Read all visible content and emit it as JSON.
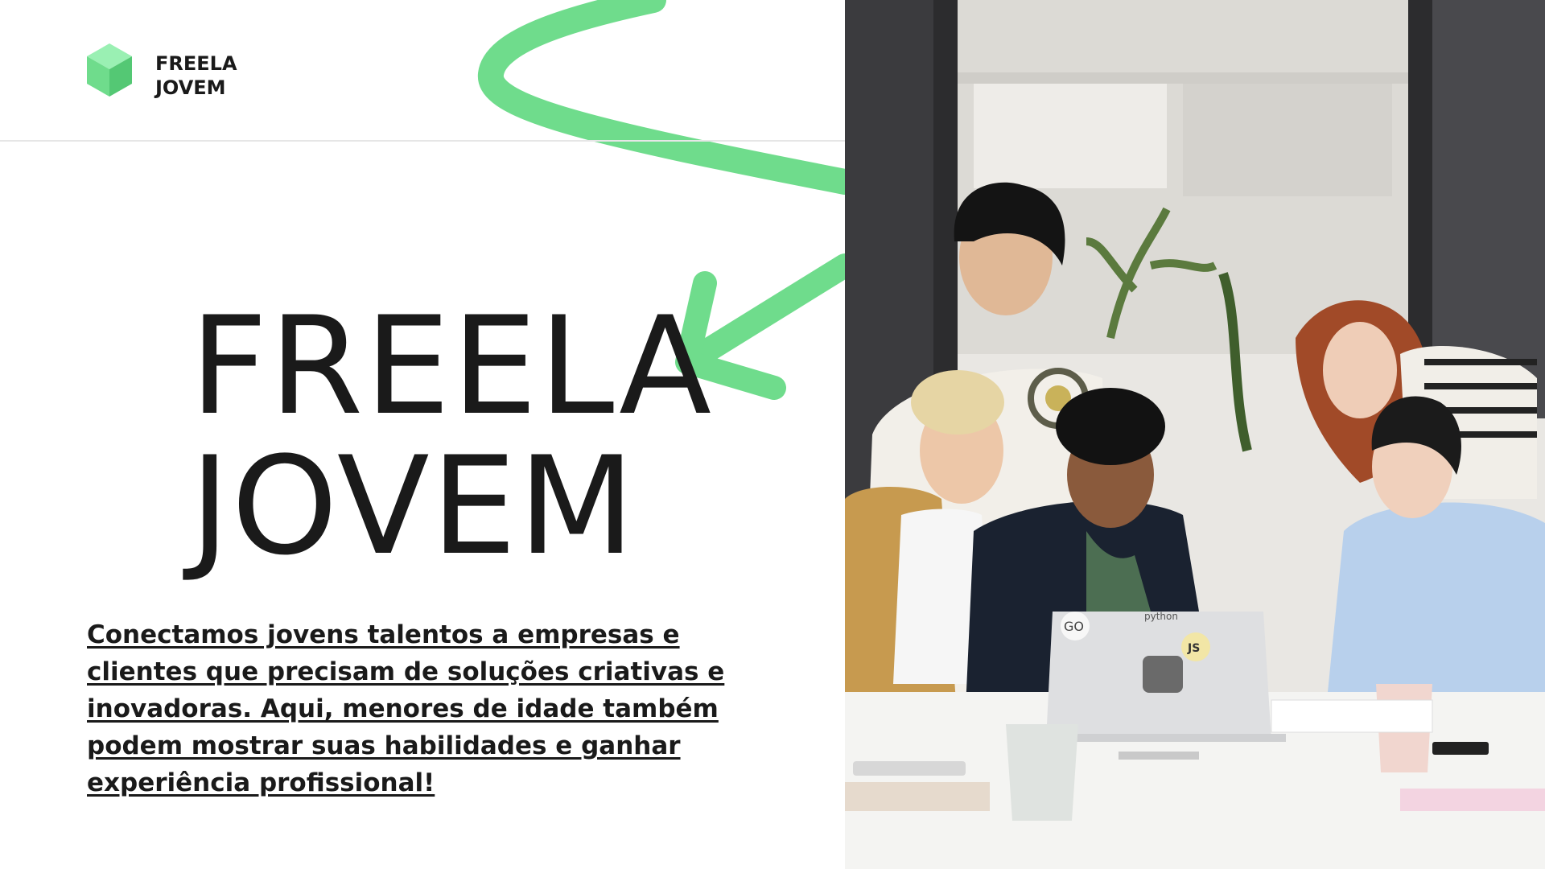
{
  "brand": {
    "line1": "FREELA",
    "line2": "JOVEM",
    "logo_icon": "cube-logo-icon",
    "accent_color": "#6fdc8c"
  },
  "hero": {
    "title_line1": "FREELA",
    "title_line2": "JOVEM"
  },
  "tagline": "Conectamos jovens talentos a empresas e clientes que precisam de soluções criativas e inovadoras. Aqui, menores de idade também podem mostrar suas habilidades e ganhar experiência profissional!",
  "decoration": {
    "swirl": "green-swirl-arrow"
  },
  "photo": {
    "laptop_stickers": [
      "GO",
      "python",
      "JS"
    ]
  }
}
